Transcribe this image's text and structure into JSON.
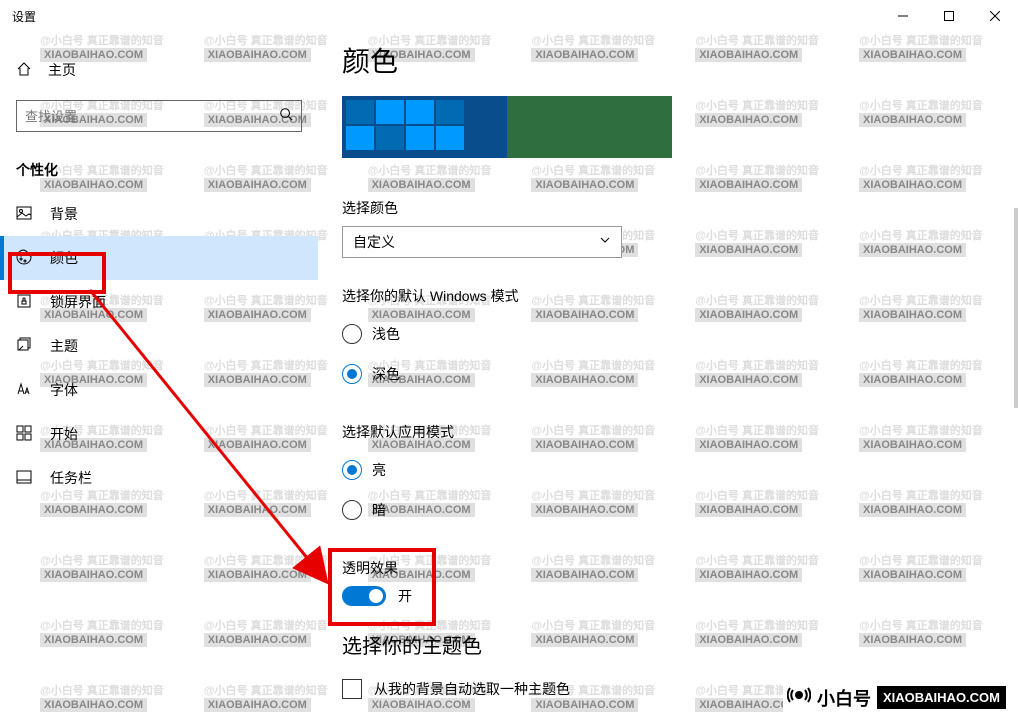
{
  "window": {
    "title": "设置"
  },
  "sidebar": {
    "home": "主页",
    "search_placeholder": "查找设置",
    "section": "个性化",
    "items": [
      {
        "label": "背景"
      },
      {
        "label": "颜色"
      },
      {
        "label": "锁屏界面"
      },
      {
        "label": "主题"
      },
      {
        "label": "字体"
      },
      {
        "label": "开始"
      },
      {
        "label": "任务栏"
      }
    ]
  },
  "content": {
    "title": "颜色",
    "choose_color_label": "选择颜色",
    "choose_color_value": "自定义",
    "windows_mode_label": "选择你的默认 Windows 模式",
    "windows_mode_options": {
      "light": "浅色",
      "dark": "深色"
    },
    "app_mode_label": "选择默认应用模式",
    "app_mode_options": {
      "light": "亮",
      "dark": "暗"
    },
    "transparency_label": "透明效果",
    "transparency_value": "开",
    "theme_color_heading": "选择你的主题色",
    "auto_pick_label": "从我的背景自动选取一种主题色"
  },
  "watermark": {
    "handle": "@小白号",
    "sub": "真正靠谱的知音",
    "domain": "XIAOBAIHAO.COM"
  },
  "badge": {
    "text": "小白号",
    "pill": "XIAOBAIHAO.COM"
  }
}
